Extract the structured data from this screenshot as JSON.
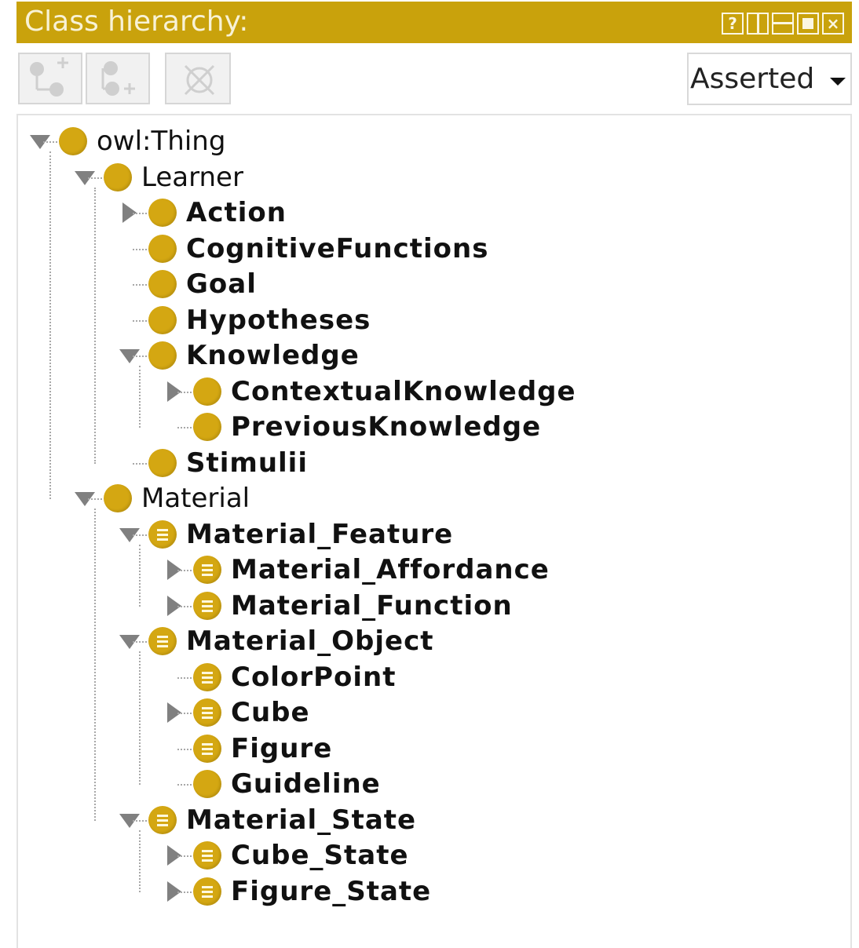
{
  "panel": {
    "title": "Class hierarchy:",
    "accent_color": "#c9a20c",
    "window_buttons": [
      {
        "name": "help-button",
        "glyph": "?"
      },
      {
        "name": "split-vertical-button",
        "glyph": ""
      },
      {
        "name": "split-horizontal-button",
        "glyph": ""
      },
      {
        "name": "maximize-button",
        "glyph": ""
      },
      {
        "name": "close-button",
        "glyph": "×"
      }
    ]
  },
  "toolbar": {
    "buttons": [
      {
        "name": "add-subclass-button",
        "icon": "add-subclass-icon"
      },
      {
        "name": "add-sibling-class-button",
        "icon": "add-sibling-icon"
      },
      {
        "name": "delete-class-button",
        "icon": "delete-class-icon"
      }
    ],
    "view_mode": "Asserted"
  },
  "tree": [
    {
      "label": "owl:Thing",
      "depth": 0,
      "toggle": "expanded",
      "bold": false,
      "icon": "class-icon"
    },
    {
      "label": "Learner",
      "depth": 1,
      "toggle": "expanded",
      "bold": false,
      "icon": "class-icon"
    },
    {
      "label": "Action",
      "depth": 2,
      "toggle": "collapsed",
      "bold": true,
      "icon": "class-icon"
    },
    {
      "label": "CognitiveFunctions",
      "depth": 2,
      "toggle": "none",
      "bold": true,
      "icon": "class-icon"
    },
    {
      "label": "Goal",
      "depth": 2,
      "toggle": "none",
      "bold": true,
      "icon": "class-icon"
    },
    {
      "label": "Hypotheses",
      "depth": 2,
      "toggle": "none",
      "bold": true,
      "icon": "class-icon"
    },
    {
      "label": "Knowledge",
      "depth": 2,
      "toggle": "expanded",
      "bold": true,
      "icon": "class-icon"
    },
    {
      "label": "ContextualKnowledge",
      "depth": 3,
      "toggle": "collapsed",
      "bold": true,
      "icon": "class-icon"
    },
    {
      "label": "PreviousKnowledge",
      "depth": 3,
      "toggle": "none",
      "bold": true,
      "icon": "class-icon"
    },
    {
      "label": "Stimulii",
      "depth": 2,
      "toggle": "none",
      "bold": true,
      "icon": "class-icon"
    },
    {
      "label": "Material",
      "depth": 1,
      "toggle": "expanded",
      "bold": false,
      "icon": "class-icon"
    },
    {
      "label": "Material_Feature",
      "depth": 2,
      "toggle": "expanded",
      "bold": true,
      "icon": "defined-class-icon"
    },
    {
      "label": "Material_Affordance",
      "depth": 3,
      "toggle": "collapsed",
      "bold": true,
      "icon": "defined-class-icon"
    },
    {
      "label": "Material_Function",
      "depth": 3,
      "toggle": "collapsed",
      "bold": true,
      "icon": "defined-class-icon"
    },
    {
      "label": "Material_Object",
      "depth": 2,
      "toggle": "expanded",
      "bold": true,
      "icon": "defined-class-icon"
    },
    {
      "label": "ColorPoint",
      "depth": 3,
      "toggle": "none",
      "bold": true,
      "icon": "defined-class-icon"
    },
    {
      "label": "Cube",
      "depth": 3,
      "toggle": "collapsed",
      "bold": true,
      "icon": "defined-class-icon"
    },
    {
      "label": "Figure",
      "depth": 3,
      "toggle": "none",
      "bold": true,
      "icon": "defined-class-icon"
    },
    {
      "label": "Guideline",
      "depth": 3,
      "toggle": "none",
      "bold": true,
      "icon": "class-icon"
    },
    {
      "label": "Material_State",
      "depth": 2,
      "toggle": "expanded",
      "bold": true,
      "icon": "defined-class-icon"
    },
    {
      "label": "Cube_State",
      "depth": 3,
      "toggle": "collapsed",
      "bold": true,
      "icon": "defined-class-icon"
    },
    {
      "label": "Figure_State",
      "depth": 3,
      "toggle": "collapsed",
      "bold": true,
      "icon": "defined-class-icon"
    }
  ]
}
